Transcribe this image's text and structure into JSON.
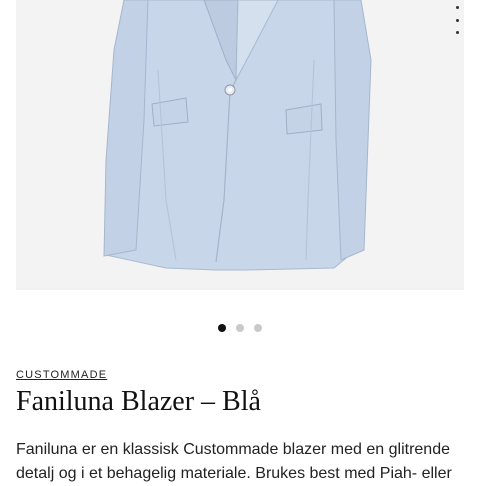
{
  "gallery": {
    "image_alt": "Faniluna Blazer – Blå",
    "more_icon": "more-vertical-icon",
    "dots": [
      {
        "active": true
      },
      {
        "active": false
      },
      {
        "active": false
      }
    ],
    "colors": {
      "blazer": "#c8d6ea",
      "background": "#f3f3f3"
    }
  },
  "product": {
    "brand": "CUSTOMMADE",
    "title": "Faniluna Blazer – Blå",
    "description": "Faniluna er en klassisk Custommade blazer med en glitrende detalj og i et behagelig materiale. Brukes best med Piah- eller"
  }
}
